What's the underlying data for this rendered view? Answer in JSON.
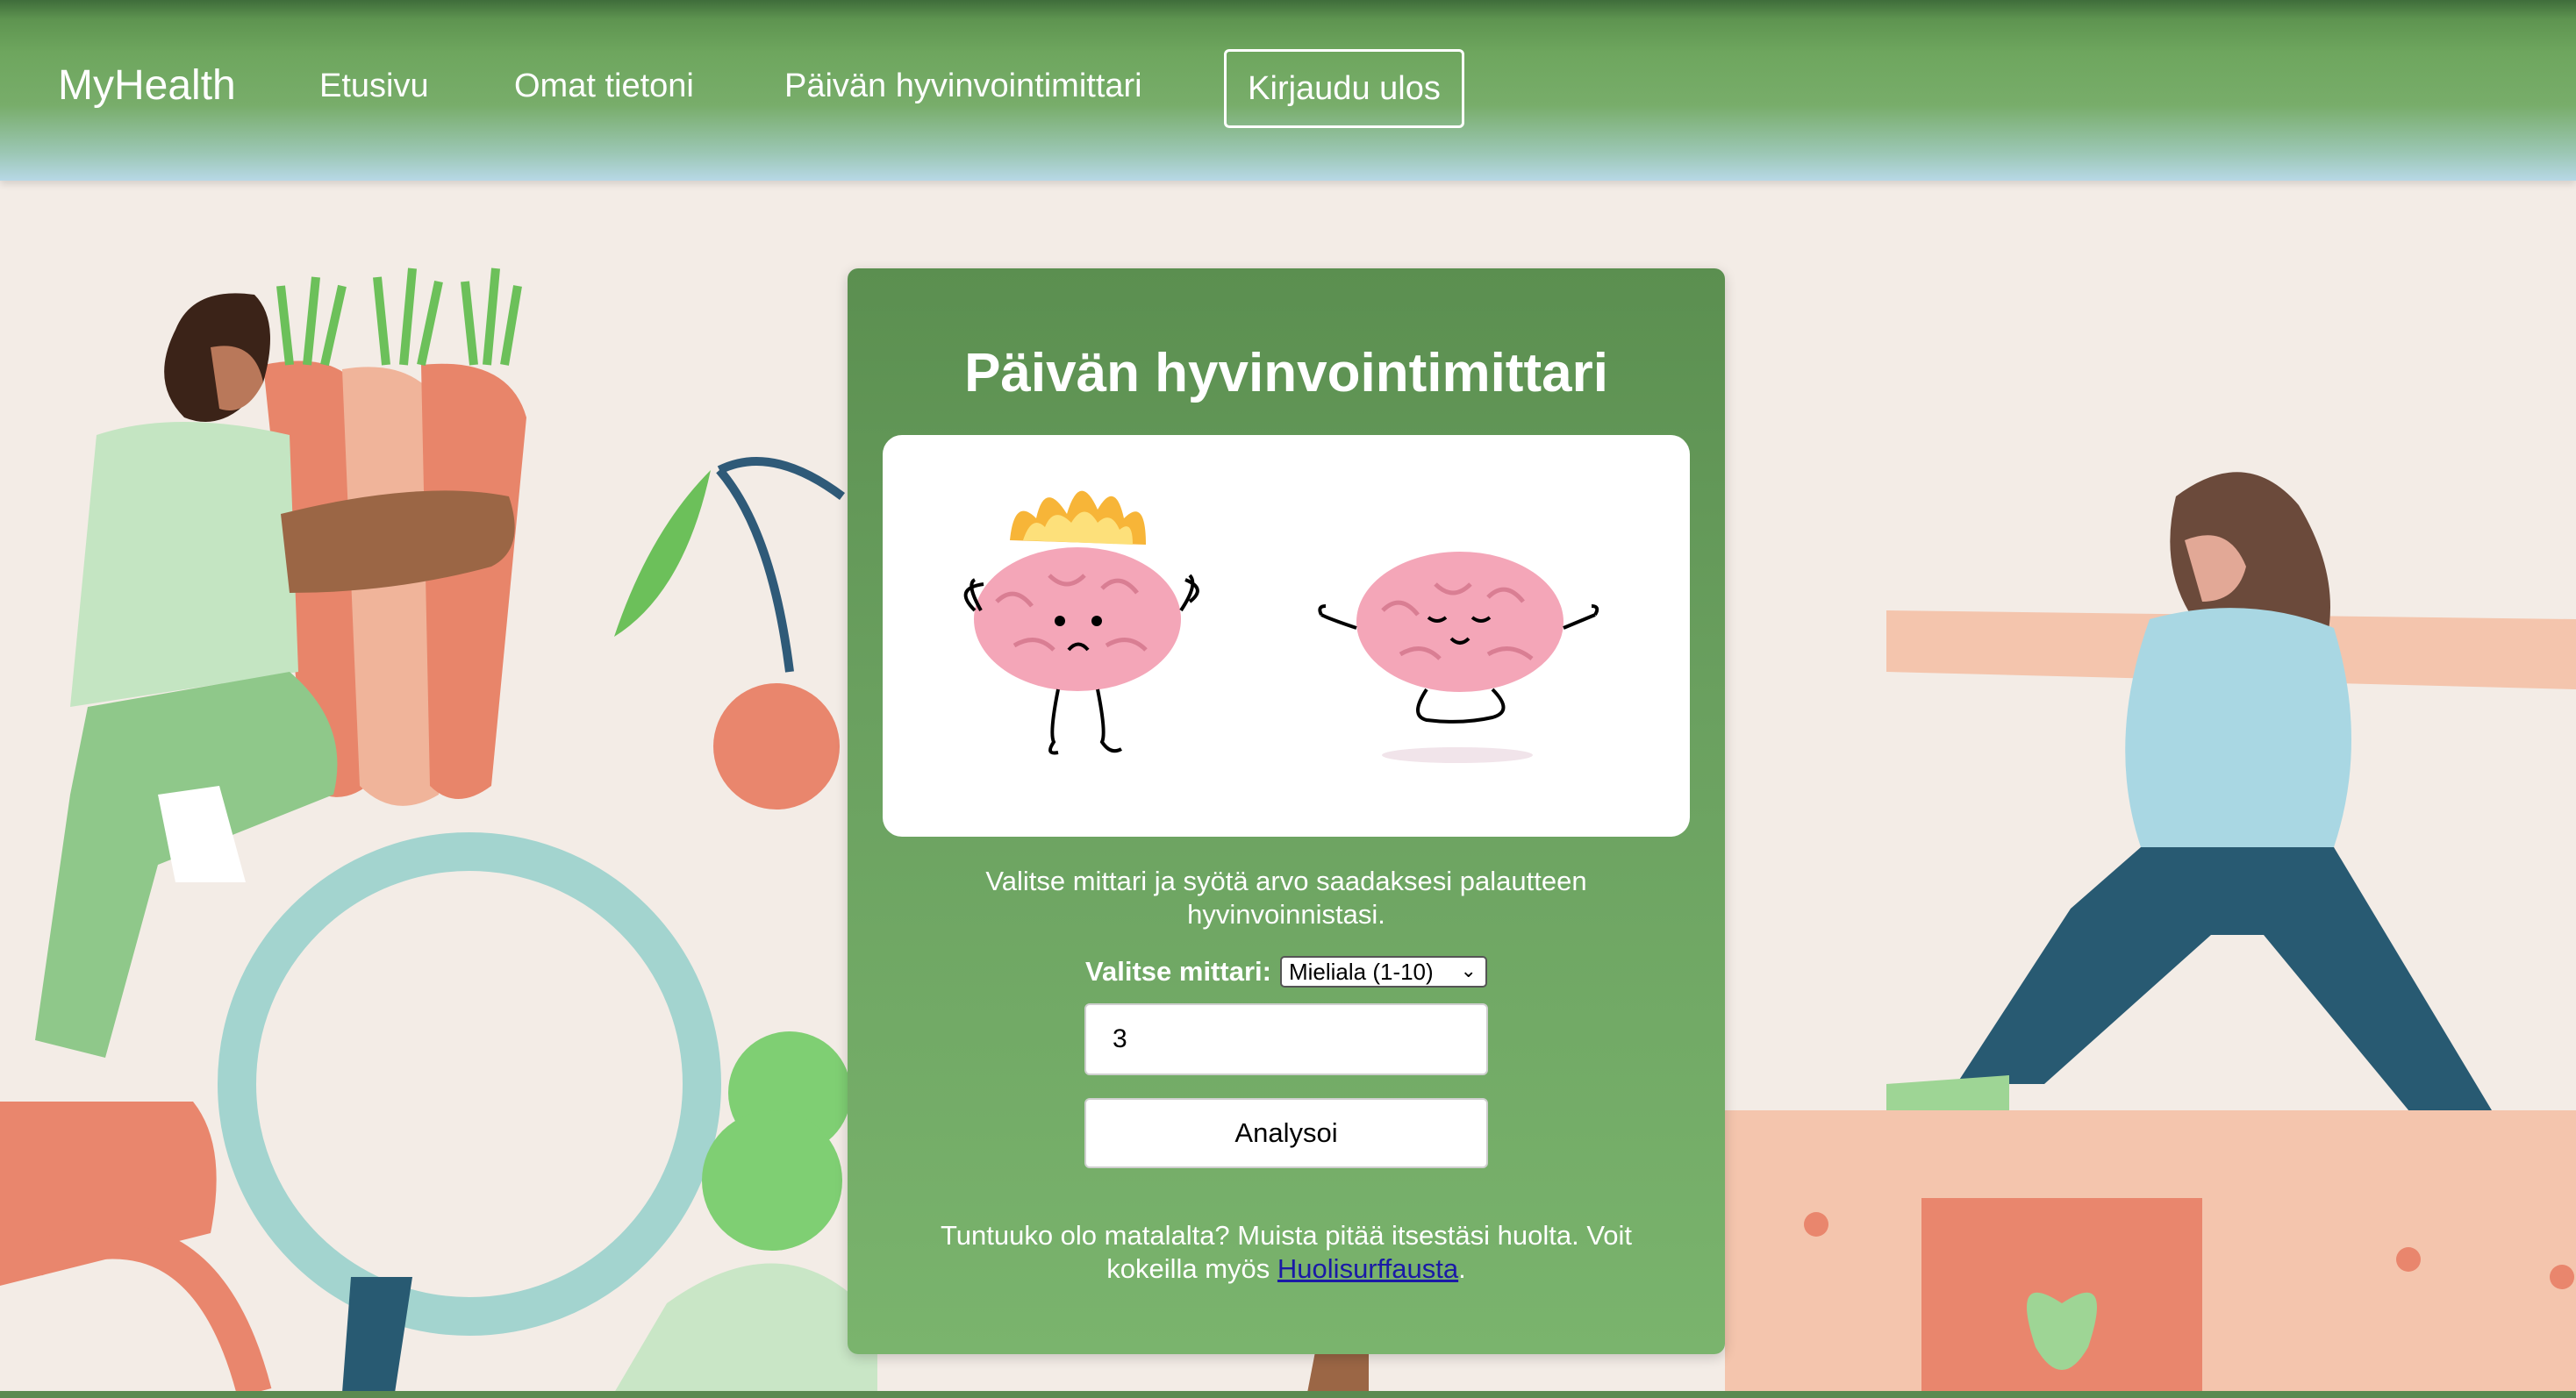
{
  "nav": {
    "brand": "MyHealth",
    "links": [
      "Etusivu",
      "Omat tietoni",
      "Päivän hyvinvointimittari"
    ],
    "logout_label": "Kirjaudu ulos"
  },
  "card": {
    "title": "Päivän hyvinvointimittari",
    "instructions": "Valitse mittari ja syötä arvo saadaksesi palautteen hyvinvoinnistasi.",
    "select_label": "Valitse mittari:",
    "select_value": "Mieliala (1-10)",
    "input_value": "3",
    "analyze_label": "Analysoi",
    "feedback_text": "Tuntuuko olo matalalta? Muista pitää itsestäsi huolta. Voit kokeilla myös ",
    "feedback_link": "Huolisurffausta",
    "feedback_end": "."
  },
  "colors": {
    "header_green": "#6ea65e",
    "card_green": "#6aa05f",
    "link_blue": "#1a1aa6",
    "brain_pink": "#f4a6b8"
  },
  "icons": [
    "angry-brain-icon",
    "calm-brain-icon",
    "chevron-down-icon"
  ]
}
